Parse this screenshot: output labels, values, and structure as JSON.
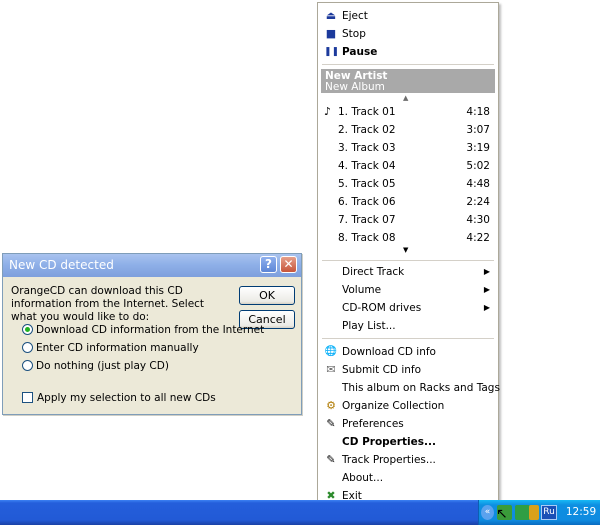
{
  "dialog": {
    "title": "New CD detected",
    "help_glyph": "?",
    "close_glyph": "✕",
    "message": "OrangeCD can download this CD information from the Internet. Select what you would like to do:",
    "ok_label": "OK",
    "cancel_label": "Cancel",
    "options": [
      {
        "label": "Download CD information from the Internet",
        "checked": true
      },
      {
        "label": "Enter CD information manually",
        "checked": false
      },
      {
        "label": "Do nothing (just play CD)",
        "checked": false
      }
    ],
    "apply_all_label": "Apply my selection to all new CDs"
  },
  "menu": {
    "controls": [
      {
        "icon": "eject-icon",
        "glyph": "⏏",
        "label": "Eject"
      },
      {
        "icon": "stop-icon",
        "glyph": "■",
        "label": "Stop"
      },
      {
        "icon": "pause-icon",
        "glyph": "❚❚",
        "label": "Pause"
      }
    ],
    "artist": "New Artist",
    "album": "New Album",
    "scroll_up": "▲",
    "scroll_down": "▼",
    "now_playing_glyph": "♪",
    "tracks": [
      {
        "title": "1. Track 01",
        "duration": "4:18"
      },
      {
        "title": "2. Track 02",
        "duration": "3:07"
      },
      {
        "title": "3. Track 03",
        "duration": "3:19"
      },
      {
        "title": "4. Track 04",
        "duration": "5:02"
      },
      {
        "title": "5. Track 05",
        "duration": "4:48"
      },
      {
        "title": "6. Track 06",
        "duration": "2:24"
      },
      {
        "title": "7. Track 07",
        "duration": "4:30"
      },
      {
        "title": "8. Track 08",
        "duration": "4:22"
      }
    ],
    "submenu_arrow": "▶",
    "submenus": [
      "Direct Track",
      "Volume",
      "CD-ROM drives"
    ],
    "play_list": "Play List...",
    "actions": [
      {
        "icon": "globe-icon",
        "glyph": "🌐",
        "label": "Download CD info",
        "bold": false
      },
      {
        "icon": "envelope-icon",
        "glyph": "✉",
        "label": "Submit CD info",
        "bold": false
      },
      {
        "icon": "",
        "glyph": "",
        "label": "This album on Racks and Tags",
        "bold": false
      },
      {
        "icon": "organize-icon",
        "glyph": "⚙",
        "label": "Organize Collection",
        "bold": false
      },
      {
        "icon": "preferences-icon",
        "glyph": "✎",
        "label": "Preferences",
        "bold": false
      },
      {
        "icon": "",
        "glyph": "",
        "label": "CD Properties...",
        "bold": true
      },
      {
        "icon": "track-properties-icon",
        "glyph": "✎",
        "label": "Track Properties...",
        "bold": false
      },
      {
        "icon": "",
        "glyph": "",
        "label": "About...",
        "bold": false
      },
      {
        "icon": "exit-icon",
        "glyph": "✖",
        "label": "Exit",
        "bold": false
      }
    ]
  },
  "taskbar": {
    "chevron_glyph": "«",
    "language": "Ru",
    "clock": "12:59",
    "cursor_glyph": "↖"
  }
}
